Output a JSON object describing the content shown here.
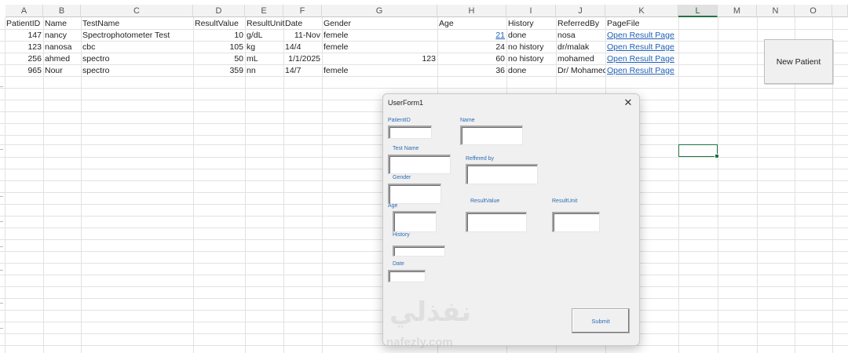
{
  "columns": [
    "A",
    "B",
    "C",
    "D",
    "E",
    "F",
    "G",
    "H",
    "I",
    "J",
    "K",
    "L",
    "M",
    "N",
    "O"
  ],
  "selected_column": "L",
  "headers": [
    "PatientID",
    "Name",
    "TestName",
    "ResultValue",
    "ResultUnit",
    "Date",
    "Gender",
    "",
    "Age",
    "History",
    "ReferredBy",
    "PageFile"
  ],
  "rows": [
    {
      "id": "147",
      "name": "nancy",
      "test": "Spectrophotometer Test",
      "value": "10",
      "unit": "g/dL",
      "date": "11-Nov",
      "gender": "femele",
      "g2": "",
      "age": "21",
      "history": "done",
      "ref": "nosa",
      "file": "Open Result Page"
    },
    {
      "id": "123",
      "name": "nanosa",
      "test": "cbc",
      "value": "105",
      "unit": "kg",
      "date": "14/4",
      "gender": "femele",
      "g2": "",
      "age": "24",
      "history": "no history",
      "ref": "dr/malak",
      "file": "Open Result Page"
    },
    {
      "id": "256",
      "name": "ahmed",
      "test": "spectro",
      "value": "50",
      "unit": "mL",
      "date": "1/1/2025",
      "gender": "",
      "g2": "123",
      "age": "60",
      "history": "no history",
      "ref": "mohamed",
      "file": "Open Result Page"
    },
    {
      "id": "965",
      "name": "Nour",
      "test": "spectro",
      "value": "359",
      "unit": "nn",
      "date": "14/7",
      "gender": "femele",
      "g2": "",
      "age": "36",
      "history": "done",
      "ref": "Dr/ Mohamed",
      "file": "Open Result Page"
    }
  ],
  "new_patient_label": "New Patient",
  "form": {
    "title": "UserForm1",
    "close_glyph": "✕",
    "labels": {
      "patient_id": "PatientID",
      "name": "Name",
      "test_name": "Test Name",
      "referred_by": "Reffered by",
      "gender": "Gender",
      "age": "Age",
      "result_value": "ResultValue",
      "result_unit": "ResultUnit",
      "history": "History",
      "date": "Date"
    },
    "submit_label": "Submit"
  },
  "watermark": {
    "arabic": "نفذلي",
    "latin": "nafezly.com"
  }
}
